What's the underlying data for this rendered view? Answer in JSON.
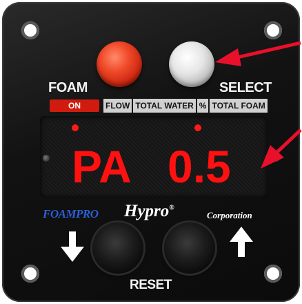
{
  "panel": {
    "foam_label": "FOAM",
    "on_label": "ON",
    "select_label": "SELECT",
    "modes": [
      "FLOW",
      "TOTAL WATER",
      "%",
      "TOTAL FOAM"
    ]
  },
  "display": {
    "mode": "PA",
    "value": "0.5"
  },
  "branding": {
    "foampro": "FOAMPRO",
    "hypro": "Hypro",
    "hypro_registered": "®",
    "hypro_sub": "Corporation"
  },
  "controls": {
    "reset_label": "RESET",
    "down_arrow": "down-arrow-icon",
    "up_arrow": "up-arrow-icon"
  },
  "colors": {
    "display_red": "#ff1111",
    "on_badge": "#d01c0f",
    "foampro_blue": "#2b5fd9",
    "annotation_arrow": "#e8102a"
  }
}
